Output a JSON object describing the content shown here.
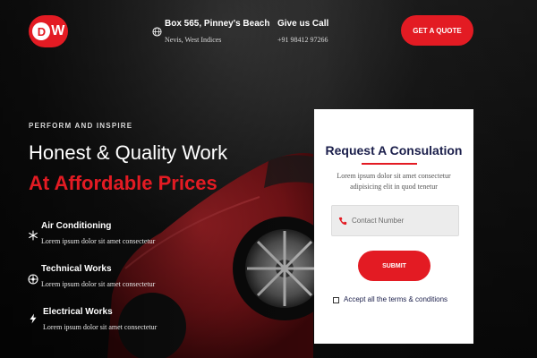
{
  "colors": {
    "accent": "#e31b23",
    "card_title": "#1b1f4b"
  },
  "header": {
    "logo_text": "DW",
    "address": {
      "icon": "globe-icon",
      "title": "Box 565, Pinney's Beach",
      "subtitle": "Nevis, West Indices"
    },
    "call": {
      "title": "Give us Call",
      "phone": "+91 98412 97266"
    },
    "quote_button": "GET A QUOTE"
  },
  "hero": {
    "eyebrow": "PERFORM AND INSPIRE",
    "headline": "Honest & Quality Work",
    "headline_accent": "At Affordable Prices",
    "features": [
      {
        "icon": "snowflake-icon",
        "title": "Air Conditioning",
        "description": "Lorem ipsum dolor sit amet consectetur"
      },
      {
        "icon": "wheel-icon",
        "title": "Technical Works",
        "description": "Lorem ipsum dolor sit amet consectetur"
      },
      {
        "icon": "lightning-icon",
        "title": "Electrical Works",
        "description": "Lorem ipsum dolor sit amet consectetur"
      }
    ]
  },
  "form": {
    "title": "Request A Consulation",
    "description": "Lorem ipsum dolor sit amet consectetur adipisicing elit in quod tenetur",
    "contact_placeholder": "Contact Number",
    "contact_icon": "phone-icon",
    "submit_label": "SUBMIT",
    "terms_label": "Accept all the terms & conditions",
    "terms_checked": false
  }
}
